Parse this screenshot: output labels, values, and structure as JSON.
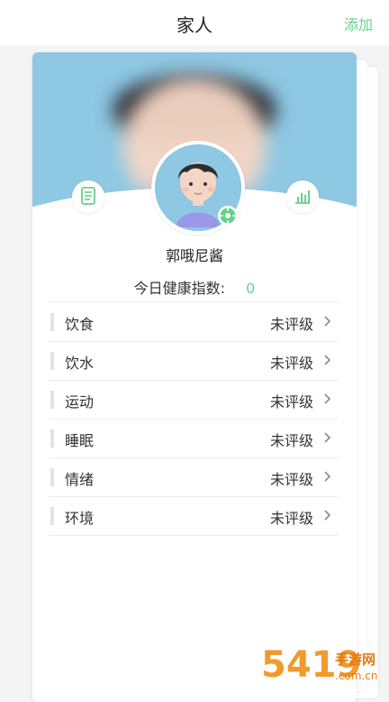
{
  "header": {
    "title": "家人",
    "add_label": "添加"
  },
  "profile": {
    "name": "郭哦尼酱",
    "health_label": "今日健康指数:",
    "health_score": "0"
  },
  "rows": [
    {
      "label": "饮食",
      "value": "未评级"
    },
    {
      "label": "饮水",
      "value": "未评级"
    },
    {
      "label": "运动",
      "value": "未评级"
    },
    {
      "label": "睡眠",
      "value": "未评级"
    },
    {
      "label": "情绪",
      "value": "未评级"
    },
    {
      "label": "环境",
      "value": "未评级"
    }
  ],
  "watermark": {
    "big": "5419",
    "small": "手游网",
    "domain": ".com.cn"
  },
  "colors": {
    "accent": "#67d08c",
    "hero": "#8ec8e3",
    "watermark": "#f29a2c"
  }
}
